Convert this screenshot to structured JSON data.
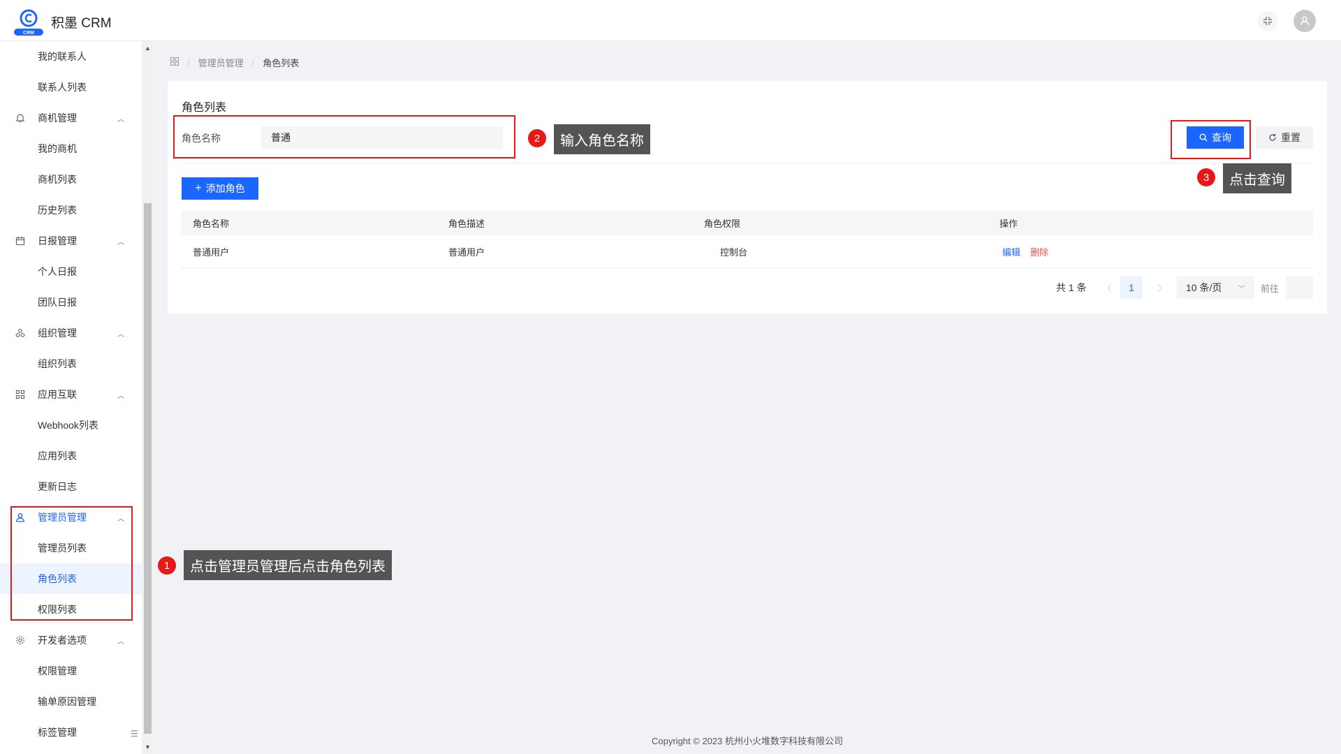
{
  "header": {
    "logo_text": "CRM",
    "app_title": "积墨 CRM",
    "icons": [
      "fullscreen-exit-icon",
      "user-avatar-icon"
    ]
  },
  "sidebar": {
    "items": [
      {
        "label": "我的联系人",
        "type": "sub"
      },
      {
        "label": "联系人列表",
        "type": "sub"
      },
      {
        "label": "商机管理",
        "type": "group",
        "icon": "bell-icon"
      },
      {
        "label": "我的商机",
        "type": "sub"
      },
      {
        "label": "商机列表",
        "type": "sub"
      },
      {
        "label": "历史列表",
        "type": "sub"
      },
      {
        "label": "日报管理",
        "type": "group",
        "icon": "calendar-icon"
      },
      {
        "label": "个人日报",
        "type": "sub"
      },
      {
        "label": "团队日报",
        "type": "sub"
      },
      {
        "label": "组织管理",
        "type": "group",
        "icon": "org-icon"
      },
      {
        "label": "组织列表",
        "type": "sub"
      },
      {
        "label": "应用互联",
        "type": "group",
        "icon": "apps-icon"
      },
      {
        "label": "Webhook列表",
        "type": "sub"
      },
      {
        "label": "应用列表",
        "type": "sub"
      },
      {
        "label": "更新日志",
        "type": "sub"
      },
      {
        "label": "管理员管理",
        "type": "group",
        "icon": "user-icon"
      },
      {
        "label": "管理员列表",
        "type": "sub"
      },
      {
        "label": "角色列表",
        "type": "sub"
      },
      {
        "label": "权限列表",
        "type": "sub"
      },
      {
        "label": "开发者选项",
        "type": "group",
        "icon": "gear-icon"
      },
      {
        "label": "权限管理",
        "type": "sub"
      },
      {
        "label": "输单原因管理",
        "type": "sub"
      },
      {
        "label": "标签管理",
        "type": "sub"
      }
    ]
  },
  "breadcrumb": {
    "level1": "管理员管理",
    "level2": "角色列表"
  },
  "card": {
    "title": "角色列表",
    "form": {
      "label": "角色名称",
      "value": "普通"
    },
    "buttons": {
      "query": "查询",
      "reset": "重置",
      "add": "添加角色"
    }
  },
  "table": {
    "headers": [
      "角色名称",
      "角色描述",
      "角色权限",
      "操作"
    ],
    "rows": [
      {
        "name": "普通用户",
        "desc": "普通用户",
        "perm": "控制台",
        "edit": "编辑",
        "delete": "删除"
      }
    ]
  },
  "pagination": {
    "total": "共 1 条",
    "current_page": "1",
    "page_size": "10 条/页",
    "goto": "前往"
  },
  "annotations": {
    "step1_num": "1",
    "step1_text": "点击管理员管理后点击角色列表",
    "step2_num": "2",
    "step2_text": "输入角色名称",
    "step3_num": "3",
    "step3_text": "点击查询",
    "box_color": "#e81818"
  },
  "footer": {
    "copyright": "Copyright © 2023 杭州小火堆数字科技有限公司"
  },
  "colors": {
    "primary": "#1a66ff",
    "danger": "#ff4d4f"
  }
}
